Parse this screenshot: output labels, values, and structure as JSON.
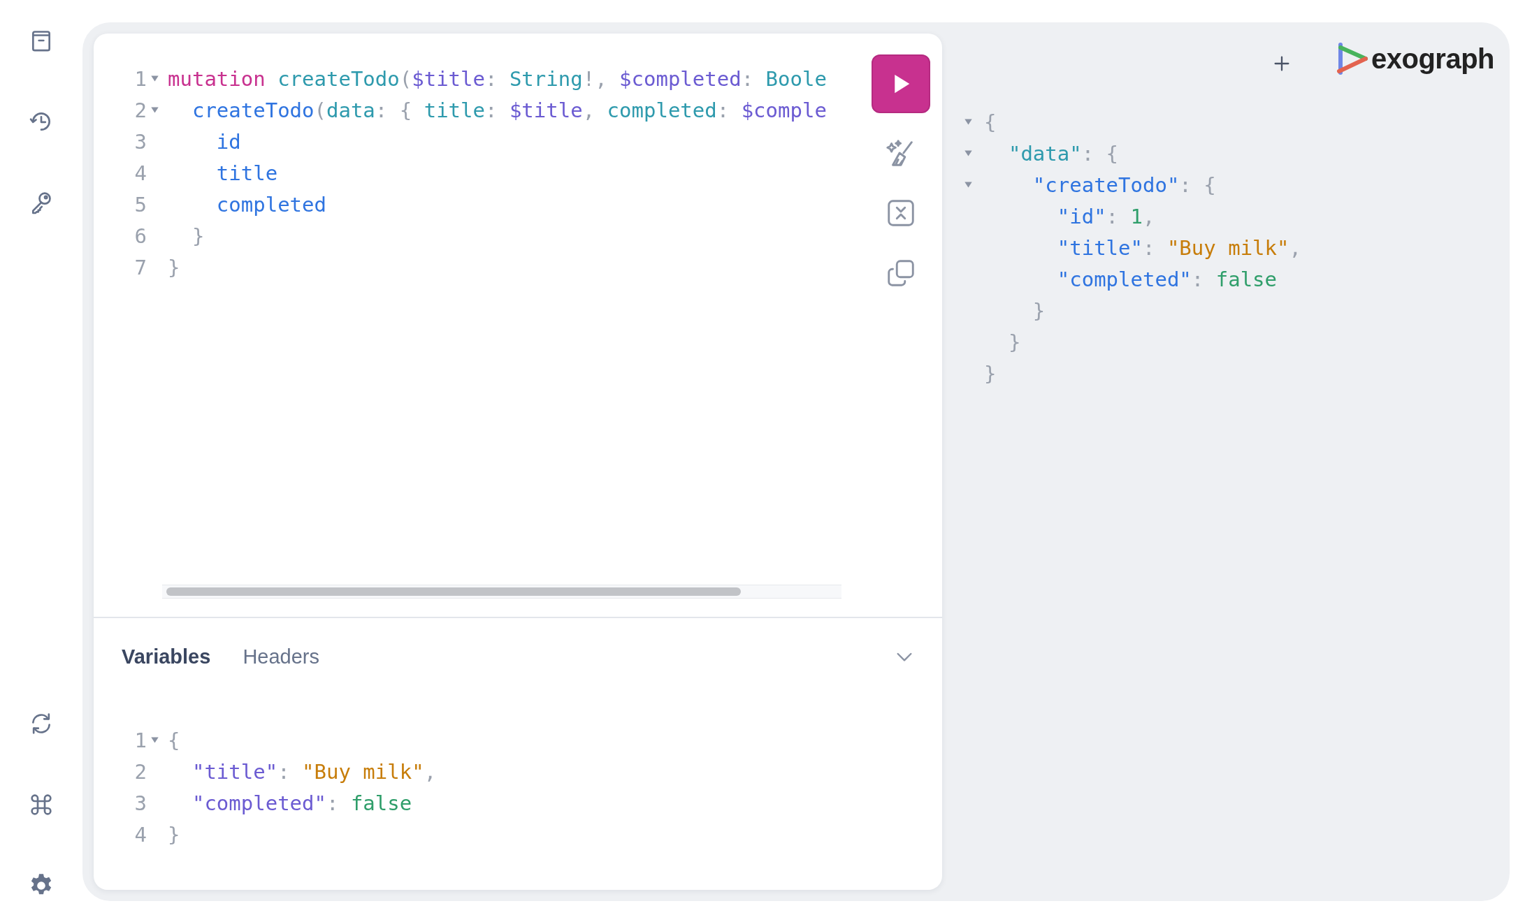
{
  "sidebar": {
    "top_items": [
      {
        "kind": "docs"
      },
      {
        "kind": "history"
      },
      {
        "kind": "key"
      }
    ],
    "bottom_items": [
      {
        "kind": "refresh"
      },
      {
        "kind": "shortcuts"
      },
      {
        "kind": "settings"
      }
    ]
  },
  "editor": {
    "lines": [
      {
        "number": "1",
        "foldable": true,
        "tokens": [
          {
            "kind": "keyword",
            "text": "mutation "
          },
          {
            "kind": "name",
            "text": "createTodo"
          },
          {
            "kind": "punct",
            "text": "("
          },
          {
            "kind": "variable",
            "text": "$title"
          },
          {
            "kind": "punct",
            "text": ": "
          },
          {
            "kind": "name",
            "text": "String"
          },
          {
            "kind": "punct",
            "text": "!, "
          },
          {
            "kind": "variable",
            "text": "$completed"
          },
          {
            "kind": "punct",
            "text": ": "
          },
          {
            "kind": "name",
            "text": "Boole"
          }
        ]
      },
      {
        "number": "2",
        "foldable": true,
        "tokens": [
          {
            "kind": "field",
            "text": "  createTodo"
          },
          {
            "kind": "punct",
            "text": "("
          },
          {
            "kind": "name",
            "text": "data"
          },
          {
            "kind": "punct",
            "text": ": { "
          },
          {
            "kind": "name",
            "text": "title"
          },
          {
            "kind": "punct",
            "text": ": "
          },
          {
            "kind": "variable",
            "text": "$title"
          },
          {
            "kind": "punct",
            "text": ", "
          },
          {
            "kind": "name",
            "text": "completed"
          },
          {
            "kind": "punct",
            "text": ": "
          },
          {
            "kind": "variable",
            "text": "$comple"
          }
        ]
      },
      {
        "number": "3",
        "foldable": false,
        "tokens": [
          {
            "kind": "field",
            "text": "    id"
          }
        ]
      },
      {
        "number": "4",
        "foldable": false,
        "tokens": [
          {
            "kind": "field",
            "text": "    title"
          }
        ]
      },
      {
        "number": "5",
        "foldable": false,
        "tokens": [
          {
            "kind": "field",
            "text": "    completed"
          }
        ]
      },
      {
        "number": "6",
        "foldable": false,
        "tokens": [
          {
            "kind": "punct",
            "text": "  }"
          }
        ]
      },
      {
        "number": "7",
        "foldable": false,
        "tokens": [
          {
            "kind": "punct",
            "text": "}"
          }
        ]
      }
    ]
  },
  "toolbar": [
    {
      "kind": "run"
    },
    {
      "kind": "prettify"
    },
    {
      "kind": "merge"
    },
    {
      "kind": "copy"
    }
  ],
  "bottom_tabs": [
    {
      "label": "Variables",
      "selected": true
    },
    {
      "label": "Headers",
      "selected": false
    }
  ],
  "variables": {
    "lines": [
      {
        "number": "1",
        "foldable": true,
        "tokens": [
          {
            "kind": "punct",
            "text": "{"
          }
        ]
      },
      {
        "number": "2",
        "foldable": false,
        "tokens": [
          {
            "kind": "variable",
            "text": "  \"title\""
          },
          {
            "kind": "punct",
            "text": ": "
          },
          {
            "kind": "string",
            "text": "\"Buy milk\""
          },
          {
            "kind": "punct",
            "text": ","
          }
        ]
      },
      {
        "number": "3",
        "foldable": false,
        "tokens": [
          {
            "kind": "variable",
            "text": "  \"completed\""
          },
          {
            "kind": "punct",
            "text": ": "
          },
          {
            "kind": "literal",
            "text": "false"
          }
        ]
      },
      {
        "number": "4",
        "foldable": false,
        "tokens": [
          {
            "kind": "punct",
            "text": "}"
          }
        ]
      }
    ]
  },
  "header": {
    "logo_text": "exograph"
  },
  "result": {
    "lines": [
      {
        "foldable": true,
        "tokens": [
          {
            "kind": "punct",
            "text": "{"
          }
        ]
      },
      {
        "foldable": true,
        "tokens": [
          {
            "kind": "name",
            "text": "  \"data\""
          },
          {
            "kind": "punct",
            "text": ": {"
          }
        ]
      },
      {
        "foldable": true,
        "tokens": [
          {
            "kind": "field",
            "text": "    \"createTodo\""
          },
          {
            "kind": "punct",
            "text": ": {"
          }
        ]
      },
      {
        "foldable": false,
        "tokens": [
          {
            "kind": "field",
            "text": "      \"id\""
          },
          {
            "kind": "punct",
            "text": ": "
          },
          {
            "kind": "literal",
            "text": "1"
          },
          {
            "kind": "punct",
            "text": ","
          }
        ]
      },
      {
        "foldable": false,
        "tokens": [
          {
            "kind": "field",
            "text": "      \"title\""
          },
          {
            "kind": "punct",
            "text": ": "
          },
          {
            "kind": "string",
            "text": "\"Buy milk\""
          },
          {
            "kind": "punct",
            "text": ","
          }
        ]
      },
      {
        "foldable": false,
        "tokens": [
          {
            "kind": "field",
            "text": "      \"completed\""
          },
          {
            "kind": "punct",
            "text": ": "
          },
          {
            "kind": "literal",
            "text": "false"
          }
        ]
      },
      {
        "foldable": false,
        "tokens": [
          {
            "kind": "punct",
            "text": "    }"
          }
        ]
      },
      {
        "foldable": false,
        "tokens": [
          {
            "kind": "punct",
            "text": "  }"
          }
        ]
      },
      {
        "foldable": false,
        "tokens": [
          {
            "kind": "punct",
            "text": "}"
          }
        ]
      }
    ]
  }
}
